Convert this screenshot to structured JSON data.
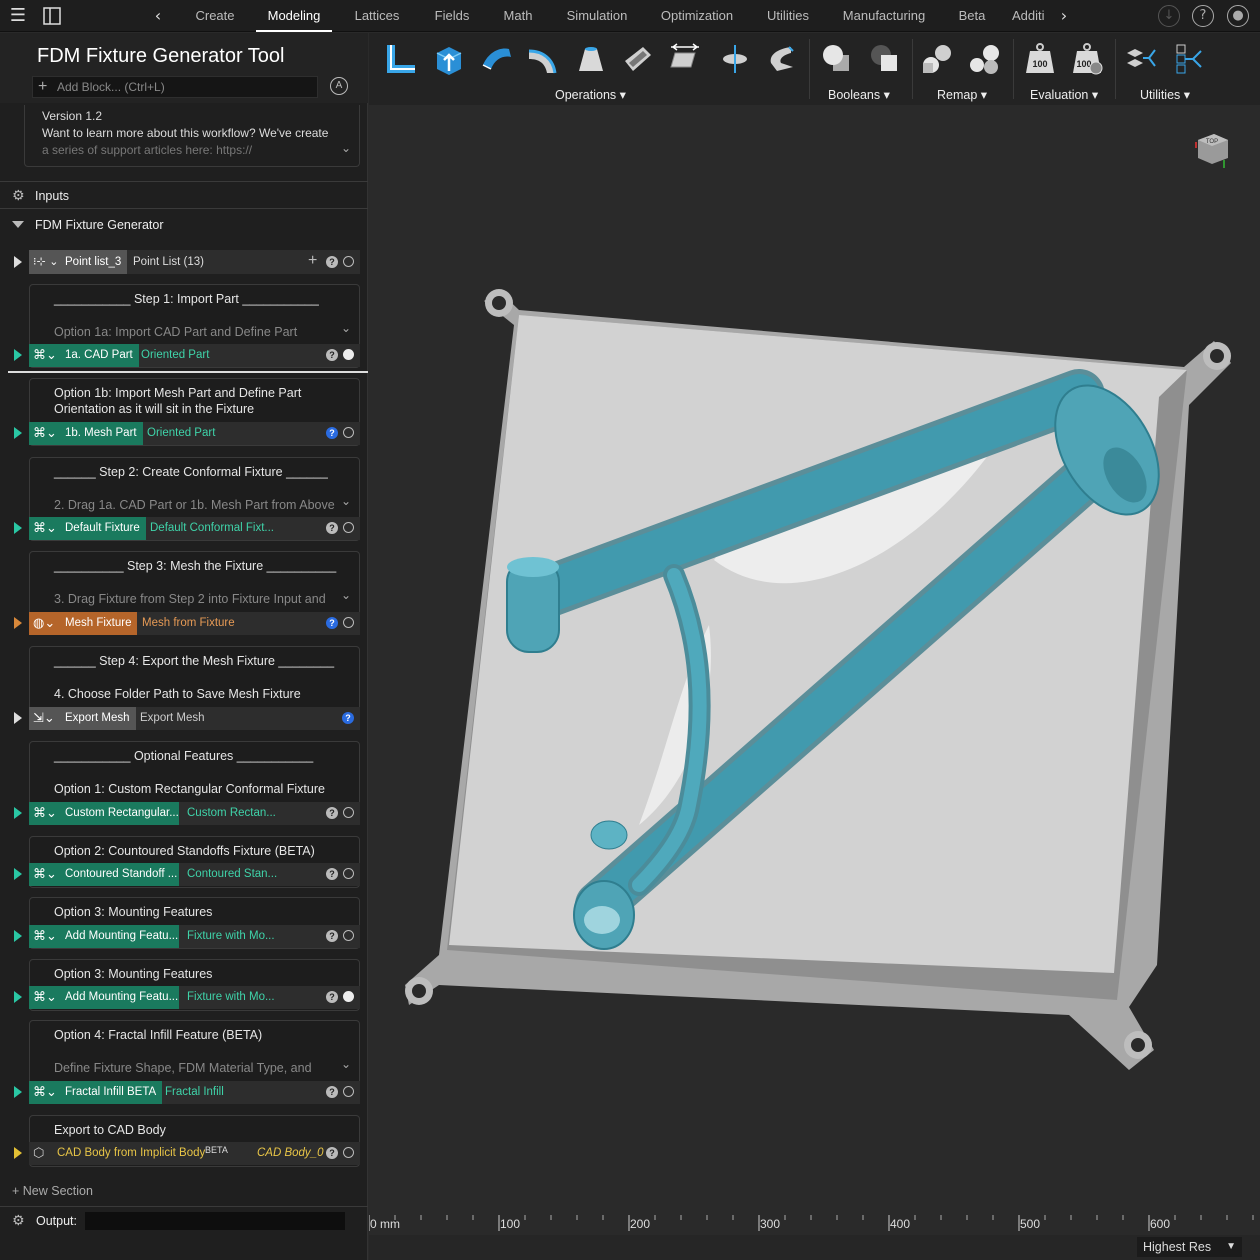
{
  "nav": {
    "tabs": [
      "Create",
      "Modeling",
      "Lattices",
      "Fields",
      "Math",
      "Simulation",
      "Optimization",
      "Utilities",
      "Manufacturing",
      "Beta",
      "Additi"
    ],
    "active_tab": "Modeling"
  },
  "panel": {
    "title": "FDM Fixture Generator Tool",
    "add_block_placeholder": "Add Block... (Ctrl+L)",
    "version_lines": [
      "Version 1.2",
      "Want to learn more about this workflow? We've create",
      "a series of support articles here: https://"
    ],
    "inputs_label": "Inputs",
    "section_label": "FDM Fixture Generator",
    "point_list": {
      "chip": "Point list_3",
      "value": "Point List (13)"
    },
    "cards": [
      {
        "title": "___________ Step 1: Import Part ___________",
        "sub": "Option 1a: Import CAD Part and Define Part",
        "block": "1a. CAD Part",
        "output": "Oriented Part"
      },
      {
        "title": "Option 1b: Import Mesh Part and Define Part",
        "title2": "Orientation as it will sit in the Fixture",
        "block": "1b. Mesh Part",
        "output": "Oriented Part"
      },
      {
        "title": "______ Step 2: Create Conformal Fixture ______",
        "sub": "2. Drag 1a. CAD Part or 1b. Mesh Part from Above",
        "block": "Default Fixture",
        "output": "Default Conformal Fixt..."
      },
      {
        "title": "__________ Step 3: Mesh the Fixture __________",
        "sub": "3. Drag Fixture from Step 2 into Fixture Input and",
        "block": "Mesh Fixture",
        "output": "Mesh from Fixture"
      },
      {
        "title": "______ Step 4: Export the Mesh Fixture ________",
        "sub": "4. Choose Folder Path to Save Mesh Fixture",
        "block": "Export Mesh",
        "output": "Export Mesh"
      },
      {
        "title": "___________ Optional Features ___________",
        "sub": "Option 1: Custom Rectangular Conformal Fixture",
        "block": "Custom Rectangular...",
        "output": "Custom Rectan..."
      },
      {
        "title": "Option 2: Countoured Standoffs Fixture (BETA)",
        "block": "Contoured Standoff ...",
        "output": "Contoured Stan..."
      },
      {
        "title": "Option 3: Mounting Features",
        "block": "Add Mounting Featu...",
        "output": "Fixture with Mo..."
      },
      {
        "title": "Option 3: Mounting Features",
        "block": "Add Mounting Featu...",
        "output": "Fixture with Mo..."
      },
      {
        "title": "Option 4: Fractal Infill Feature (BETA)",
        "sub": "Define Fixture Shape, FDM Material Type, and",
        "block": "Fractal Infill BETA",
        "output": "Fractal Infill"
      },
      {
        "title": "Export to CAD Body",
        "block": "CAD Body from Implicit Body",
        "badge": "BETA",
        "output": "CAD Body_0"
      }
    ],
    "new_section": "New Section",
    "output_label": "Output:"
  },
  "toolbar": {
    "groups": [
      "Operations",
      "Booleans",
      "Remap",
      "Evaluation",
      "Utilities"
    ],
    "eval_value": "100"
  },
  "ruler": {
    "labels": [
      "0 mm",
      "100",
      "200",
      "300",
      "400",
      "500",
      "600"
    ]
  },
  "viewcube_label": "TOP",
  "resolution": "Highest Res",
  "colors": {
    "accent_green": "#1a7a5e",
    "accent_orange": "#b5652a",
    "output_green": "#3fd3a9",
    "output_orange": "#e69a55",
    "cad_yellow": "#e8c547",
    "part_blue": "#3e9bb0",
    "plate": "#d2d2d2"
  }
}
